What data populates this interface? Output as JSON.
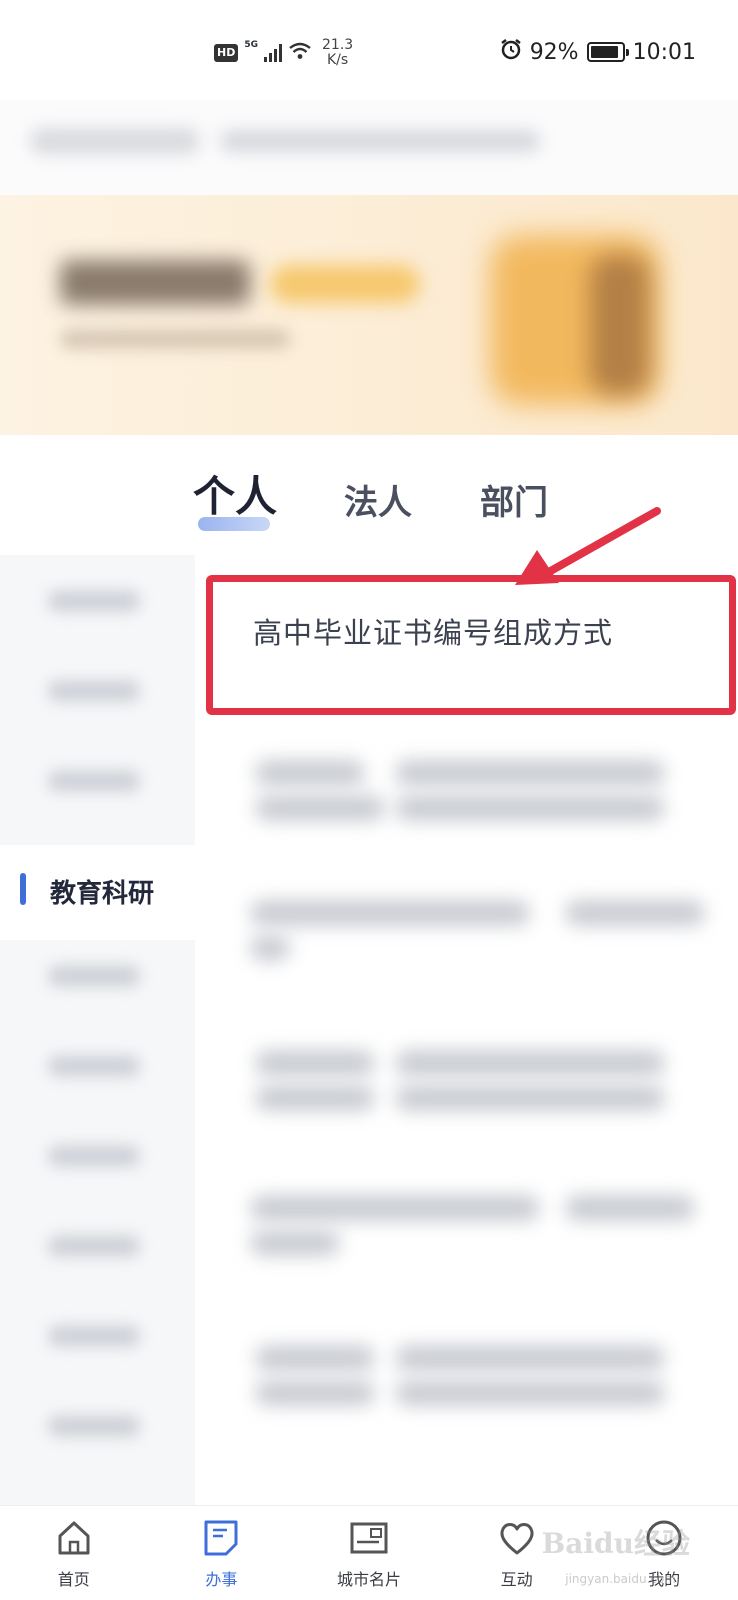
{
  "status_bar": {
    "hd": "HD",
    "network": "5G",
    "speed_value": "21.3",
    "speed_unit": "K/s",
    "battery": "92%",
    "time": "10:01"
  },
  "tabs": [
    {
      "label": "个人"
    },
    {
      "label": "法人"
    },
    {
      "label": "部门"
    }
  ],
  "sidebar": {
    "active_label": "教育科研"
  },
  "results": [
    {
      "title": "高中毕业证书编号组成方式"
    }
  ],
  "bottom_nav": [
    {
      "label": "首页",
      "icon": "home-icon"
    },
    {
      "label": "办事",
      "icon": "document-icon"
    },
    {
      "label": "城市名片",
      "icon": "postcard-icon"
    },
    {
      "label": "互动",
      "icon": "heart-icon"
    },
    {
      "label": "我的",
      "icon": "profile-icon"
    }
  ],
  "watermark": {
    "text": "Baidu经验",
    "sub": "jingyan.baidu.com"
  },
  "colors": {
    "accent": "#3e6fd8",
    "highlight": "#e23346"
  }
}
